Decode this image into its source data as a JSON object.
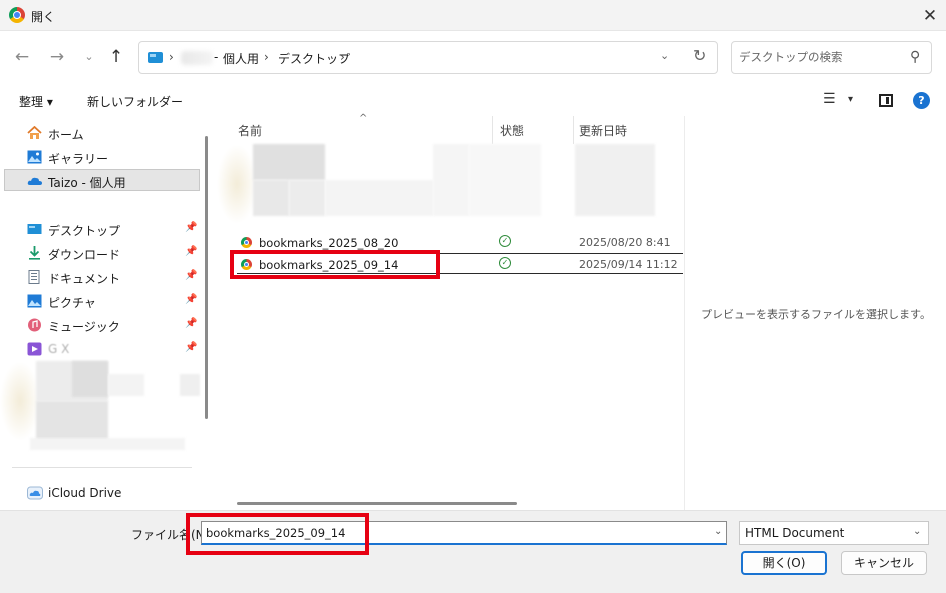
{
  "window": {
    "title": "開く",
    "close_glyph": "✕"
  },
  "nav": {
    "back_glyph": "←",
    "forward_glyph": "→",
    "history_glyph": "⌄",
    "up_glyph": "↑"
  },
  "address": {
    "crumbs": [
      "個人用",
      "デスクトップ"
    ],
    "crumb_prefix": "-",
    "separator": "›",
    "dropdown_glyph": "⌄",
    "refresh_glyph": "↻"
  },
  "search": {
    "placeholder": "デスクトップの検索",
    "icon_glyph": "⚲"
  },
  "toolbar": {
    "organize_label": "整理 ▾",
    "new_folder_label": "新しいフォルダー",
    "view_glyph": "☰",
    "view_drop_glyph": "▾",
    "help_glyph": "?"
  },
  "sidebar": {
    "items": [
      {
        "label": "ホーム",
        "icon": "home-icon"
      },
      {
        "label": "ギャラリー",
        "icon": "gallery-icon"
      },
      {
        "label": "Taizo - 個人用",
        "icon": "onedrive-icon"
      },
      {
        "label": "デスクトップ",
        "icon": "desktop-icon",
        "pinned": true
      },
      {
        "label": "ダウンロード",
        "icon": "download-icon",
        "pinned": true
      },
      {
        "label": "ドキュメント",
        "icon": "documents-icon",
        "pinned": true
      },
      {
        "label": "ピクチャ",
        "icon": "pictures-icon",
        "pinned": true
      },
      {
        "label": "ミュージック",
        "icon": "music-icon",
        "pinned": true
      },
      {
        "label": "G X",
        "icon": "videos-icon",
        "pinned": true
      },
      {
        "label": "iCloud Drive",
        "icon": "icloud-icon"
      }
    ],
    "pin_glyph": "📌"
  },
  "filelist": {
    "columns": [
      "名前",
      "状態",
      "更新日時"
    ],
    "sort_glyph": "^",
    "rows": [
      {
        "name": "bookmarks_2025_08_20",
        "status": "✓",
        "date": "2025/08/20 8:41"
      },
      {
        "name": "bookmarks_2025_09_14",
        "status": "✓",
        "date": "2025/09/14 11:12"
      }
    ]
  },
  "preview": {
    "message": "プレビューを表示するファイルを選択します。"
  },
  "bottom": {
    "filename_label": "ファイル名(N):",
    "filename_value": "bookmarks_2025_09_14",
    "filename_drop_glyph": "⌄",
    "filetype": "HTML Document",
    "filetype_drop_glyph": "⌄",
    "open_label": "開く(O)",
    "cancel_label": "キャンセル"
  },
  "colors": {
    "accent": "#1a73d1",
    "highlight_box": "#e60012",
    "status_ok": "#2e8b3a"
  }
}
